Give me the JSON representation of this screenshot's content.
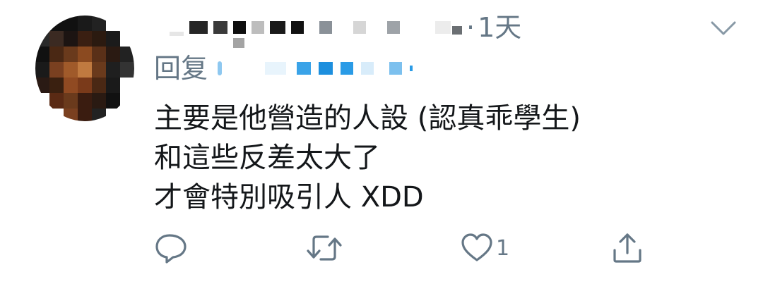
{
  "tweet": {
    "time_ago": "1天",
    "time_separator": "·",
    "reply_prefix": "回复",
    "body_lines": [
      "主要是他營造的人設 (認真乖學生)",
      "和這些反差太大了",
      "才會特別吸引人 XDD"
    ]
  },
  "actions": {
    "reply_icon": "comment-bubble-icon",
    "retweet_icon": "retweet-icon",
    "like_icon": "heart-icon",
    "like_count": "1",
    "share_icon": "share-upload-icon"
  },
  "colors": {
    "text": "#14171a",
    "secondary": "#657786",
    "link": "#1da1f2",
    "background": "#ffffff"
  }
}
